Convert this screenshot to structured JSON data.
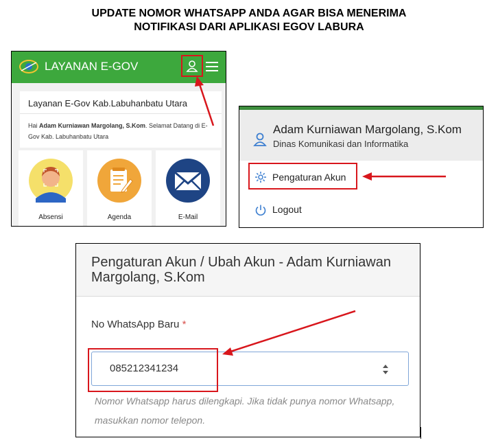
{
  "instruction": {
    "line1": "UPDATE NOMOR WHATSAPP ANDA AGAR BISA MENERIMA",
    "line2": "NOTIFIKASI DARI APLIKASI EGOV LABURA"
  },
  "app": {
    "title": "LAYANAN E-GOV",
    "logo_text": "eGOV",
    "card_title": "Layanan E-Gov Kab.Labuhanbatu Utara",
    "greeting_prefix": "Hai ",
    "greeting_name": "Adam Kurniawan Margolang, S.Kom",
    "greeting_suffix": ". Selamat Datang di E-Gov Kab. Labuhanbatu Utara",
    "tiles": [
      {
        "label": "Absensi",
        "icon": "face-scan-icon"
      },
      {
        "label": "Agenda",
        "icon": "notepad-icon"
      },
      {
        "label": "E-Mail",
        "icon": "envelope-icon"
      }
    ]
  },
  "account_menu": {
    "name": "Adam Kurniawan Margolang, S.Kom",
    "organization": "Dinas Komunikasi dan Informatika",
    "items": [
      {
        "label": "Pengaturan Akun",
        "icon": "gear-icon"
      },
      {
        "label": "Logout",
        "icon": "power-icon"
      }
    ]
  },
  "account_form": {
    "title": "Pengaturan Akun / Ubah Akun - Adam Kurniawan Margolang, S.Kom",
    "field_label": "No WhatsApp Baru",
    "required_marker": "*",
    "field_value": "085212341234",
    "help_text": "Nomor Whatsapp harus dilengkapi. Jika tidak punya nomor Whatsapp, masukkan nomor telepon."
  },
  "colors": {
    "header_green": "#3da83d",
    "highlight_red": "#d8161c",
    "panel_gray": "#ececec",
    "help_text": "#888888"
  }
}
